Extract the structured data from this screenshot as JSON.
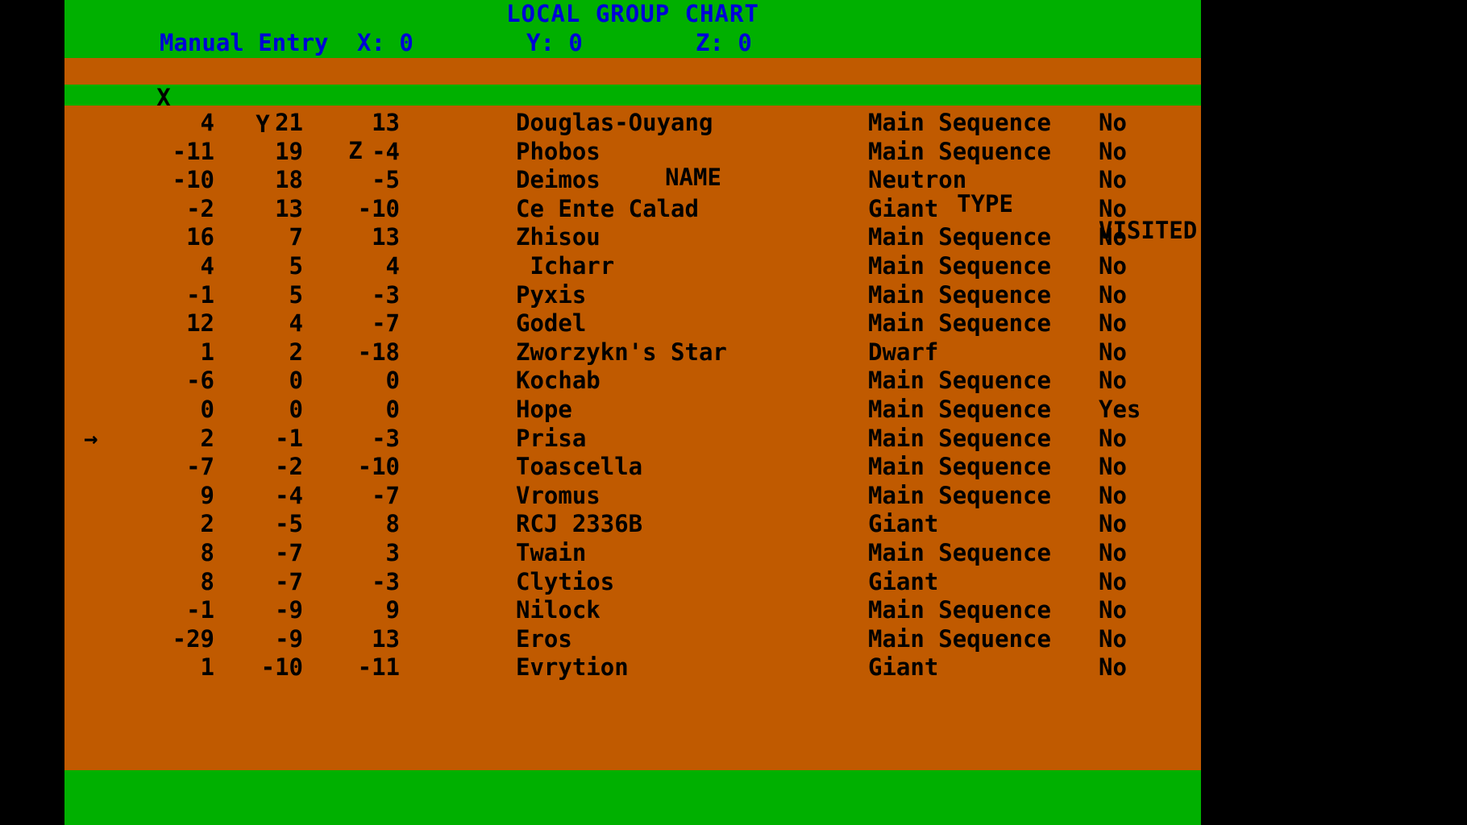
{
  "header": {
    "title": "LOCAL GROUP CHART",
    "mode_label": "Manual Entry",
    "coord_x": "X: 0",
    "coord_y": "Y: 0",
    "coord_z": "Z: 0"
  },
  "columns": {
    "x": "X",
    "y": "Y",
    "z": "Z",
    "name": "NAME",
    "type": "TYPE",
    "visited": "VISITED"
  },
  "cursor_glyph": "→",
  "selected_row_index": 11,
  "colors": {
    "background": "#000000",
    "band": "#00b000",
    "table": "#c05a00",
    "title_text": "#0000d8",
    "body_text": "#000000"
  },
  "rows": [
    {
      "cursor": "",
      "x": "4",
      "y": "21",
      "z": "13",
      "name": "Douglas-Ouyang",
      "type": "Main Sequence",
      "visited": "No"
    },
    {
      "cursor": "",
      "x": "-11",
      "y": "19",
      "z": "-4",
      "name": "Phobos",
      "type": "Main Sequence",
      "visited": "No"
    },
    {
      "cursor": "",
      "x": "-10",
      "y": "18",
      "z": "-5",
      "name": "Deimos",
      "type": "Neutron",
      "visited": "No"
    },
    {
      "cursor": "",
      "x": "-2",
      "y": "13",
      "z": "-10",
      "name": "Ce Ente Calad",
      "type": "Giant",
      "visited": "No"
    },
    {
      "cursor": "",
      "x": "16",
      "y": "7",
      "z": "13",
      "name": "Zhisou",
      "type": "Main Sequence",
      "visited": "No"
    },
    {
      "cursor": "",
      "x": "4",
      "y": "5",
      "z": "4",
      "name": " Icharr",
      "type": "Main Sequence",
      "visited": "No"
    },
    {
      "cursor": "",
      "x": "-1",
      "y": "5",
      "z": "-3",
      "name": "Pyxis",
      "type": "Main Sequence",
      "visited": "No"
    },
    {
      "cursor": "",
      "x": "12",
      "y": "4",
      "z": "-7",
      "name": "Godel",
      "type": "Main Sequence",
      "visited": "No"
    },
    {
      "cursor": "",
      "x": "1",
      "y": "2",
      "z": "-18",
      "name": "Zworzykn's Star",
      "type": "Dwarf",
      "visited": "No"
    },
    {
      "cursor": "",
      "x": "-6",
      "y": "0",
      "z": "0",
      "name": "Kochab",
      "type": "Main Sequence",
      "visited": "No"
    },
    {
      "cursor": "",
      "x": "0",
      "y": "0",
      "z": "0",
      "name": "Hope",
      "type": "Main Sequence",
      "visited": "Yes"
    },
    {
      "cursor": "→",
      "x": "2",
      "y": "-1",
      "z": "-3",
      "name": "Prisa",
      "type": "Main Sequence",
      "visited": "No"
    },
    {
      "cursor": "",
      "x": "-7",
      "y": "-2",
      "z": "-10",
      "name": "Toascella",
      "type": "Main Sequence",
      "visited": "No"
    },
    {
      "cursor": "",
      "x": "9",
      "y": "-4",
      "z": "-7",
      "name": "Vromus",
      "type": "Main Sequence",
      "visited": "No"
    },
    {
      "cursor": "",
      "x": "2",
      "y": "-5",
      "z": "8",
      "name": "RCJ 2336B",
      "type": "Giant",
      "visited": "No"
    },
    {
      "cursor": "",
      "x": "8",
      "y": "-7",
      "z": "3",
      "name": "Twain",
      "type": "Main Sequence",
      "visited": "No"
    },
    {
      "cursor": "",
      "x": "8",
      "y": "-7",
      "z": "-3",
      "name": "Clytios",
      "type": "Giant",
      "visited": "No"
    },
    {
      "cursor": "",
      "x": "-1",
      "y": "-9",
      "z": "9",
      "name": "Nilock",
      "type": "Main Sequence",
      "visited": "No"
    },
    {
      "cursor": "",
      "x": "-29",
      "y": "-9",
      "z": "13",
      "name": "Eros",
      "type": "Main Sequence",
      "visited": "No"
    },
    {
      "cursor": "",
      "x": "1",
      "y": "-10",
      "z": "-11",
      "name": "Evrytion",
      "type": "Giant",
      "visited": "No"
    }
  ]
}
